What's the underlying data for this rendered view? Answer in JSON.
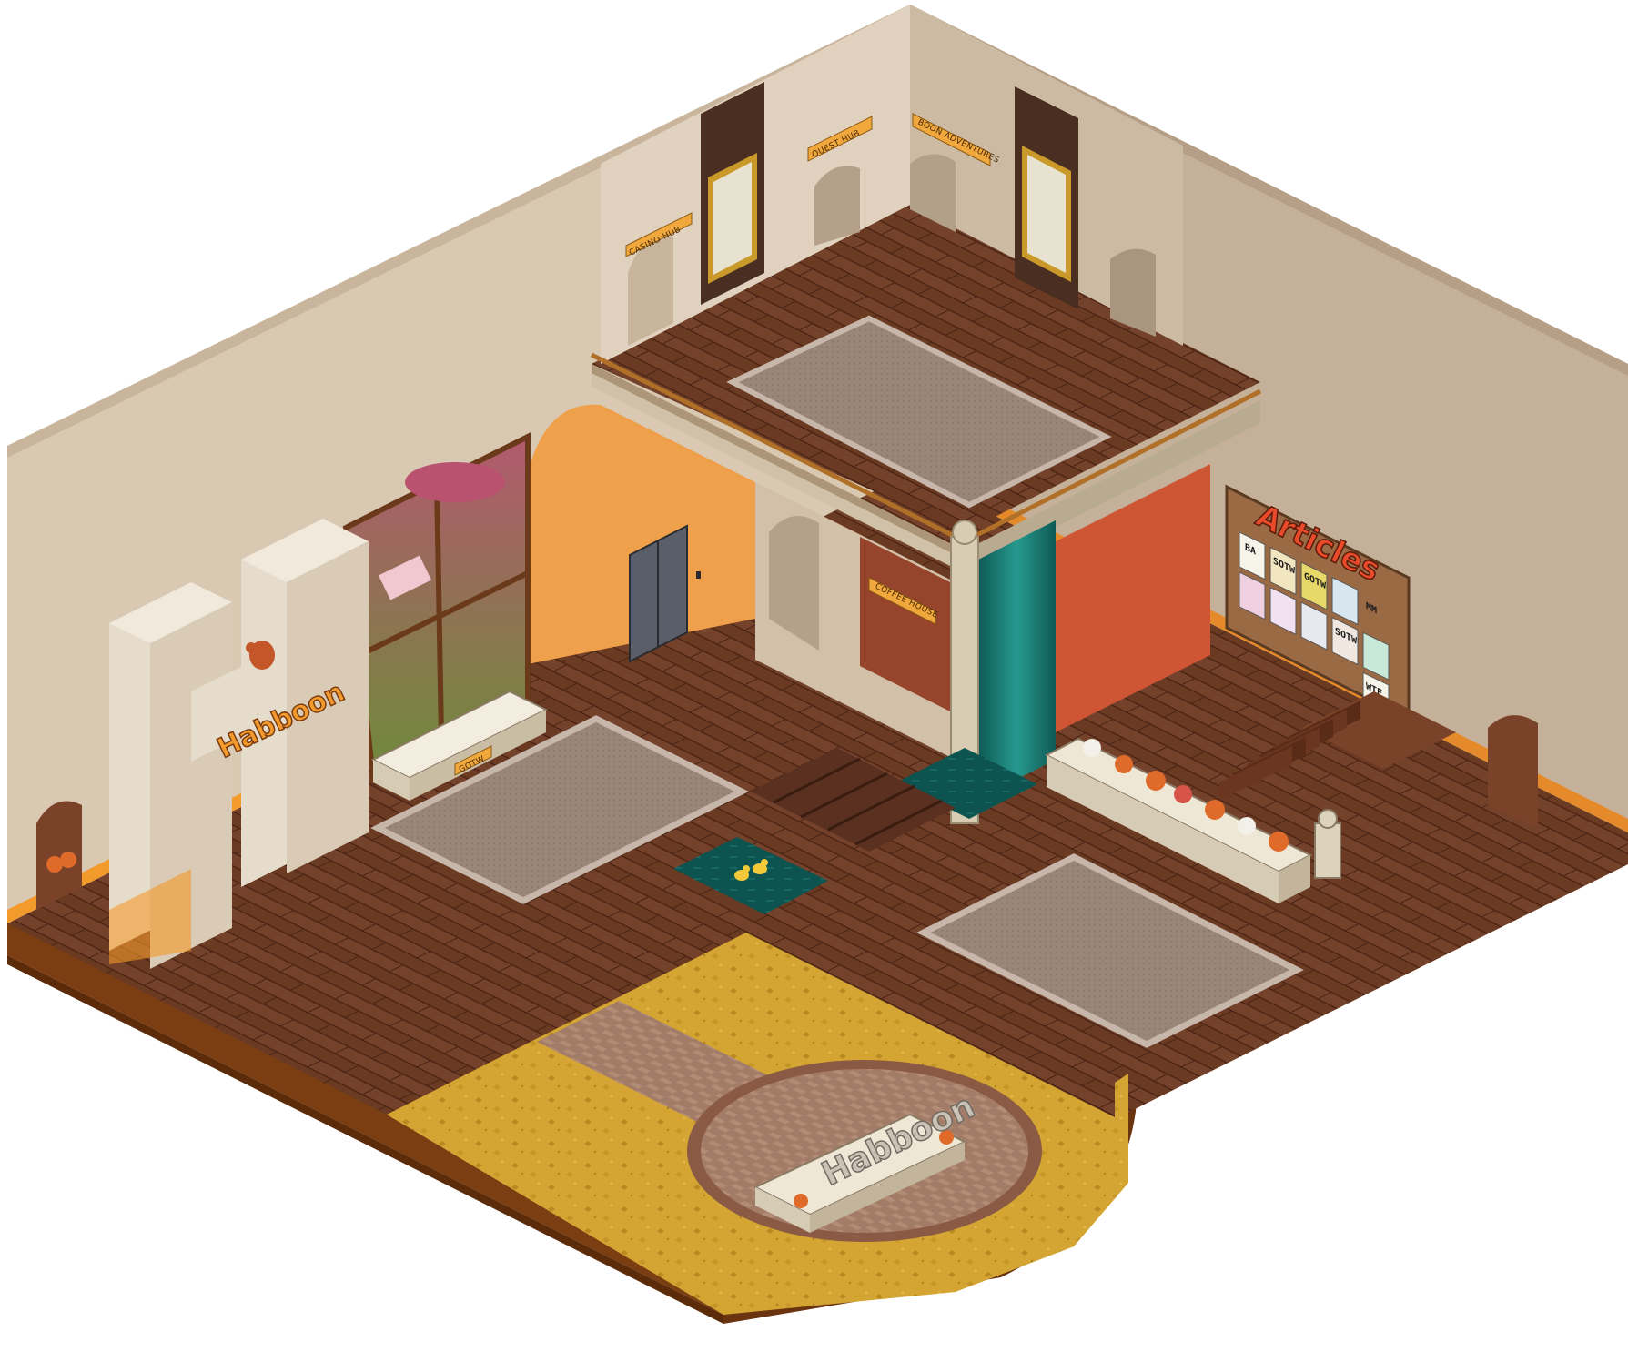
{
  "scene": {
    "brand_logo": "Habboon",
    "garden_sign_logo": "Habboon"
  },
  "signs": {
    "casino_hub": "CASINO HUB",
    "quest_hub": "QUEST HUB",
    "boon_adventures": "BOON ADVENTURES",
    "coffee_house": "COFFEE HOUSE",
    "gotw": "GOTW"
  },
  "articles_board": {
    "title": "Articles",
    "posters": [
      "BA",
      "SOTW",
      "GOTW",
      "",
      "",
      "",
      "",
      "",
      "SOTW",
      "",
      "WTF",
      "MM"
    ]
  },
  "colors": {
    "wall": "#d9c8b2",
    "wall_shade": "#b9a48c",
    "floor": "#6b3a22",
    "floor_dark": "#4e2616",
    "orange_wall": "#efa04a",
    "rust_wall": "#cf5634",
    "brown_wall": "#97442c",
    "grass": "#d4a532",
    "dirt": "#7a3e12",
    "water": "#0d5450",
    "accent_trim": "#f39a2c"
  },
  "icons": [
    "squirrel-icon",
    "duck-icon",
    "pumpkin-icon",
    "elevator-icon",
    "waterfall-icon"
  ]
}
